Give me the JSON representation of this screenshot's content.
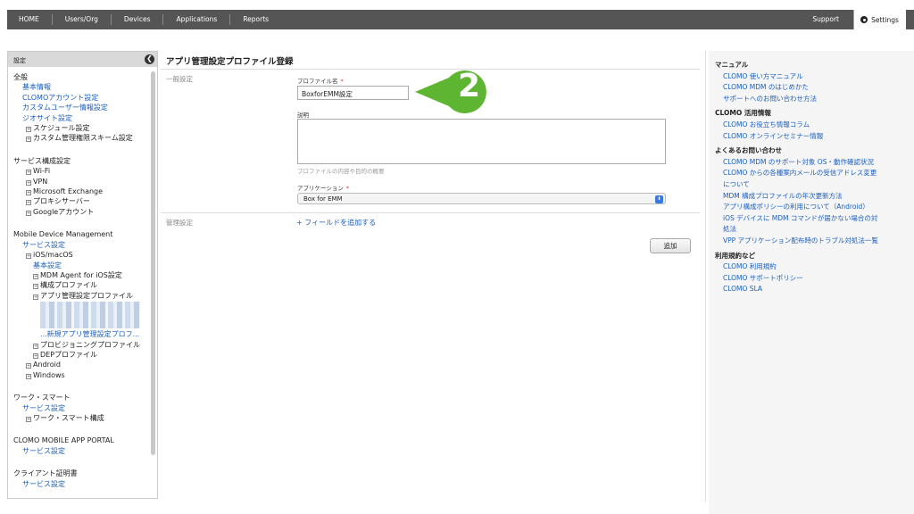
{
  "topnav": {
    "items": [
      "HOME",
      "Users/Org",
      "Devices",
      "Applications",
      "Reports"
    ],
    "support": "Support",
    "settings": "Settings"
  },
  "sidebar": {
    "header": "設定",
    "collapse_glyph": "❮",
    "lines": [
      {
        "t": "全般",
        "k": "sec",
        "i": 0
      },
      {
        "t": "基本情報",
        "k": "lnk",
        "i": 1
      },
      {
        "t": "CLOMOアカウント設定",
        "k": "lnk",
        "i": 1
      },
      {
        "t": "カスタムユーザー情報設定",
        "k": "lnk",
        "i": 1
      },
      {
        "t": "ジオサイト設定",
        "k": "lnk",
        "i": 1
      },
      {
        "t": "スケジュール設定",
        "k": "sec",
        "i": 2,
        "box": true
      },
      {
        "t": "カスタム管理権限スキーム設定",
        "k": "sec",
        "i": 2,
        "box": true
      },
      {
        "t": "",
        "k": "gap"
      },
      {
        "t": "サービス構成設定",
        "k": "sec",
        "i": 0
      },
      {
        "t": "Wi-Fi",
        "k": "sec",
        "i": 2,
        "box": true
      },
      {
        "t": "VPN",
        "k": "sec",
        "i": 2,
        "box": true
      },
      {
        "t": "Microsoft Exchange",
        "k": "sec",
        "i": 2,
        "box": true
      },
      {
        "t": "プロキシサーバー",
        "k": "sec",
        "i": 2,
        "box": true
      },
      {
        "t": "Googleアカウント",
        "k": "sec",
        "i": 2,
        "box": true
      },
      {
        "t": "",
        "k": "gap"
      },
      {
        "t": "Mobile Device Management",
        "k": "sec",
        "i": 0
      },
      {
        "t": "サービス設定",
        "k": "lnk",
        "i": 1
      },
      {
        "t": "iOS/macOS",
        "k": "sec",
        "i": 2,
        "box": true
      },
      {
        "t": "基本設定",
        "k": "lnk",
        "i": 3
      },
      {
        "t": "MDM Agent for iOS設定",
        "k": "sec",
        "i": 3,
        "box": true
      },
      {
        "t": "構成プロファイル",
        "k": "sec",
        "i": 3,
        "box": true
      },
      {
        "t": "アプリ管理設定プロファイル",
        "k": "sec",
        "i": 3,
        "box": true
      },
      {
        "t": "",
        "k": "blur"
      },
      {
        "t": "...新規アプリ管理設定プロフ...",
        "k": "lnk",
        "i": 4
      },
      {
        "t": "プロビジョニングプロファイル",
        "k": "sec",
        "i": 3,
        "box": true
      },
      {
        "t": "DEPプロファイル",
        "k": "sec",
        "i": 3,
        "box": true
      },
      {
        "t": "Android",
        "k": "sec",
        "i": 2,
        "box": true
      },
      {
        "t": "Windows",
        "k": "sec",
        "i": 2,
        "box": true
      },
      {
        "t": "",
        "k": "gap"
      },
      {
        "t": "ワーク・スマート",
        "k": "sec",
        "i": 0
      },
      {
        "t": "サービス設定",
        "k": "lnk",
        "i": 1
      },
      {
        "t": "ワーク・スマート構成",
        "k": "sec",
        "i": 2,
        "box": true
      },
      {
        "t": "",
        "k": "gap"
      },
      {
        "t": "CLOMO MOBILE APP PORTAL",
        "k": "sec",
        "i": 0
      },
      {
        "t": "サービス設定",
        "k": "lnk",
        "i": 1
      },
      {
        "t": "",
        "k": "gap"
      },
      {
        "t": "クライアント証明書",
        "k": "sec",
        "i": 0
      },
      {
        "t": "サービス設定",
        "k": "lnk",
        "i": 1
      }
    ]
  },
  "main": {
    "title": "アプリ管理設定プロファイル登録",
    "general_label": "一般設定",
    "profile_name_label": "プロファイル名",
    "profile_name_value": "BoxforEMM設定",
    "required_mark": "*",
    "description_label": "説明",
    "description_hint": "プロファイルの内容や目的の概要",
    "application_label": "アプリケーション",
    "application_value": "Box for EMM",
    "admin_label": "管理設定",
    "add_field": "+ フィールドを追加する",
    "add_button": "追加"
  },
  "callout": {
    "number": "2",
    "color": "#5db531"
  },
  "right": {
    "sections": [
      {
        "title": "マニュアル",
        "links": [
          "CLOMO 使い方マニュアル",
          "CLOMO MDM のはじめかた",
          "サポートへのお問い合わせ方法"
        ]
      },
      {
        "title": "CLOMO 活用情報",
        "links": [
          "CLOMO お役立ち情報コラム",
          "CLOMO オンラインセミナー情報"
        ]
      },
      {
        "title": "よくあるお問い合わせ",
        "links": [
          "CLOMO MDM のサポート対象 OS・動作確認状況",
          "CLOMO からの各種案内メールの受信アドレス変更",
          "について",
          "MDM 構成プロファイルの年次更新方法",
          "アプリ構成ポリシーの利用について（Android）",
          "iOS デバイスに MDM コマンドが届かない場合の対",
          "処法",
          "VPP アプリケーション配布時のトラブル対処法一覧"
        ]
      },
      {
        "title": "利用規約など",
        "links": [
          "CLOMO 利用規約",
          "CLOMO サポートポリシー",
          "CLOMO SLA"
        ]
      }
    ]
  }
}
